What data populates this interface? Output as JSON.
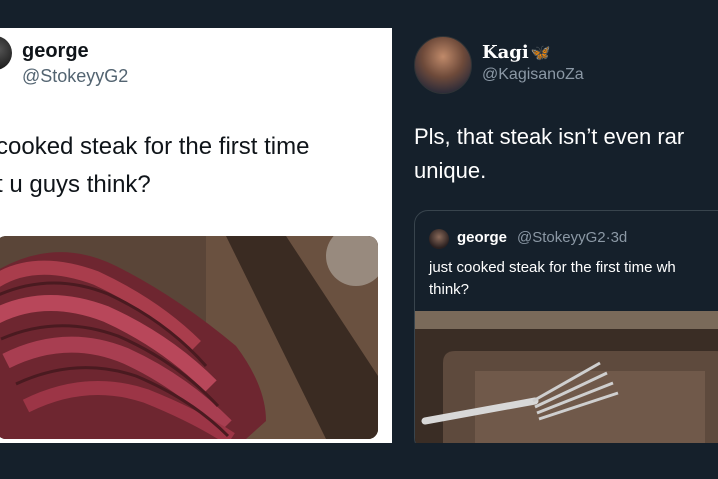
{
  "left_tweet": {
    "name": "george",
    "handle": "@StokeyyG2",
    "text_line1": "cooked steak for the first time",
    "text_line2": "t u guys think?",
    "media_alt_icon": "steak-photo"
  },
  "right_tweet": {
    "name": "Kagi",
    "name_emoji": "🦋",
    "handle": "@KagisanoZa",
    "text_line1": "Pls, that steak isn’t even rar",
    "text_line2": "unique.",
    "quote": {
      "name": "george",
      "handle": "@StokeyyG2",
      "separator": "·",
      "time": "3d",
      "text_line1": "just cooked steak for the first time wh",
      "text_line2": "think?",
      "media_alt_icon": "fork-photo"
    }
  },
  "colors": {
    "background": "#15202b",
    "light_card": "#ffffff",
    "dark_card": "#15202b",
    "muted_text_light": "#536471",
    "muted_text_dark": "#8b98a5"
  }
}
